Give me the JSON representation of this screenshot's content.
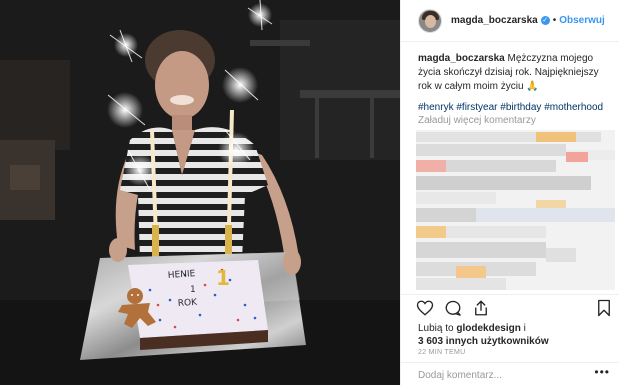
{
  "post": {
    "username": "magda_boczarska",
    "follow_label": "Obserwuj",
    "separator": "•",
    "verified_glyph": "✓",
    "caption_user": "magda_boczarska",
    "caption_text": " Mężczyzna mojego życia skończył dzisiaj rok. Najpiękniejszy rok w całym moim życiu 🙏",
    "hashtags": [
      "#henryk",
      "#firstyear",
      "#birthday",
      "#motherhood"
    ],
    "load_more": "Załaduj więcej komentarzy",
    "likes_prefix": "Lubią to ",
    "likes_user": "glodekdesign",
    "likes_mid": " i",
    "likes_count": "3 603 innych użytkowników",
    "time": "22 MIN TEMU",
    "comment_placeholder": "Dodaj komentarz...",
    "more_label": "•••"
  },
  "photo": {
    "cake_text_1": "HENIE",
    "cake_text_2": "1",
    "cake_text_3": "ROK",
    "candle_number": "1"
  },
  "icons": [
    "heart-icon",
    "comment-icon",
    "share-icon",
    "bookmark-icon",
    "verified-icon"
  ],
  "colors": {
    "link": "#3897f0",
    "hashtag": "#003569",
    "muted": "#999999",
    "text": "#262626",
    "border": "#efefef"
  }
}
